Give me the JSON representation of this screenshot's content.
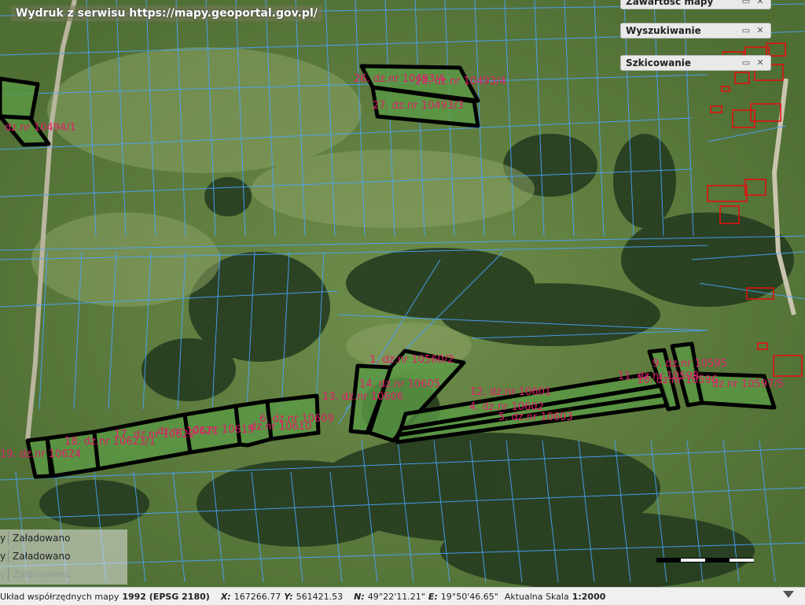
{
  "banner": "Wydruk z serwisu https://mapy.geoportal.gov.pl/",
  "panels": [
    {
      "title": "Zawartość mapy"
    },
    {
      "title": "Wyszukiwanie"
    },
    {
      "title": "Szkicowanie"
    }
  ],
  "panel_buttons": {
    "minimize": "▭",
    "close": "✕"
  },
  "layers": [
    {
      "edge": "y",
      "status": "Załadowano"
    },
    {
      "edge": "y",
      "status": "Załadowano"
    },
    {
      "edge": "y",
      "status": "Załadowano"
    }
  ],
  "parcels": [
    {
      "label": "26. dz.nr 10493/4"
    },
    {
      "label": "28. dz.nr 10493/4"
    },
    {
      "label": "27. dz.nr 10493/3"
    },
    {
      "label": "dz.nr 10494/1"
    },
    {
      "label": "1. dz.nr 10560/2"
    },
    {
      "label": "14. dz.nr 10605"
    },
    {
      "label": "13. dz.nr 10606"
    },
    {
      "label": "12. dz.nr 10601"
    },
    {
      "label": "4. dz.nr 10602"
    },
    {
      "label": "5. dz.nr 10603"
    },
    {
      "label": "9. dz.nr 10595"
    },
    {
      "label": "11. dz.nr 10598"
    },
    {
      "label": "10. dz.nr 10596"
    },
    {
      "label": "dz.nr 10597/5"
    },
    {
      "label": "19. dz.nr 10624"
    },
    {
      "label": "18. dz.nr 10623/1"
    },
    {
      "label": "17. dz.nr 10622"
    },
    {
      "label": "dz.nr 10621"
    },
    {
      "label": "dz.nr 10619"
    },
    {
      "label": "6. dz.nr 10609"
    },
    {
      "label": "dz.nr 10610"
    }
  ],
  "status": {
    "system_label": "Układ współrzędnych mapy",
    "system_value": "1992 (EPSG 2180)",
    "x_label": "X:",
    "x_value": "167266.77",
    "y_label": "Y:",
    "y_value": "561421.53",
    "n_label": "N:",
    "n_value": "49°22'11.21\"",
    "e_label": "E:",
    "e_value": "19°50'46.65\"",
    "scale_label": "Aktualna Skala",
    "scale_value": "1:2000"
  },
  "colors": {
    "parcel_fill": "#5a9a45",
    "parcel_stroke": "#000000",
    "cadastre_line": "#4aa3ff",
    "building": "#e01010",
    "label": "#e0206a"
  }
}
